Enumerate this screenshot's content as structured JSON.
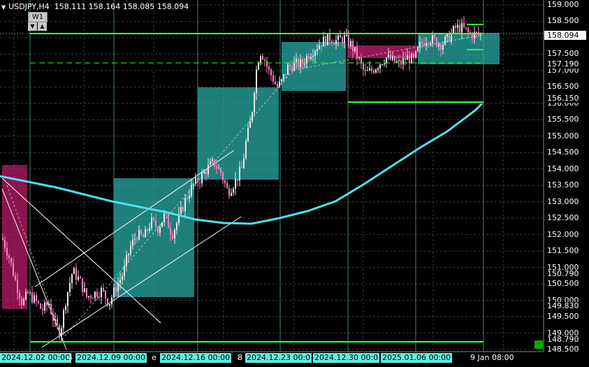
{
  "header": {
    "symbol": "USDJPY,H4",
    "open": "158.111",
    "high": "158.164",
    "low": "158.085",
    "close": "158.094"
  },
  "timeframe": {
    "label": "W1",
    "down_icon": "arrow-down-icon",
    "up_icon": "arrow-up-icon"
  },
  "price_axis": [
    "159.000",
    "158.500",
    "158.000",
    "157.500",
    "157.000",
    "156.500",
    "156.000",
    "155.500",
    "155.000",
    "154.500",
    "154.000",
    "153.500",
    "153.000",
    "152.500",
    "152.000",
    "151.500",
    "151.000",
    "150.500",
    "150.000",
    "149.500",
    "149.000",
    "148.500"
  ],
  "price_tags": [
    {
      "text": "158.094",
      "bg": "#ffffff"
    },
    {
      "text": "157.190",
      "bg": "none"
    },
    {
      "text": "156.150",
      "bg": "none"
    },
    {
      "text": "150.790",
      "bg": "none"
    },
    {
      "text": "149.830",
      "bg": "none"
    },
    {
      "text": "148.790",
      "bg": "none"
    }
  ],
  "time_axis": [
    {
      "text": "2024.12.02 00:00",
      "highlight": true
    },
    {
      "text": "4",
      "highlight": false
    },
    {
      "text": "2024.12.09 00:00",
      "highlight": true
    },
    {
      "text": "e",
      "highlight": false
    },
    {
      "text": "2024.12.16 00:00",
      "highlight": true
    },
    {
      "text": "8",
      "highlight": false
    },
    {
      "text": "2024.12.23 00:0",
      "highlight": true
    },
    {
      "text": "2024.12.30 00:0",
      "highlight": true
    },
    {
      "text": "2025.01.06 00:00",
      "highlight": true
    },
    {
      "text": "9 Jan 08:00",
      "highlight": false
    }
  ],
  "corner_button": "-",
  "colors": {
    "background": "#000000",
    "grid": "#3a3a3a",
    "bull": "#e8e8e8",
    "bear": "#ff7fbf",
    "ma": "#4ee0ee",
    "zone_teal": "#2aa9a4",
    "zone_magenta": "#b81b6a",
    "level_green": "#33ff33",
    "week_sep": "#7fe0e0"
  }
}
